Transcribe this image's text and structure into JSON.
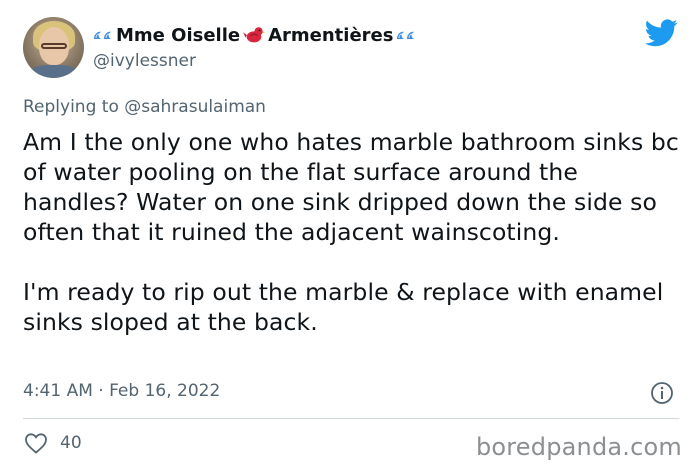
{
  "user": {
    "display_name_part1": "Mme Oiselle",
    "display_name_part2": "Armentières",
    "handle": "@ivylessner",
    "emoji_wave": "water-wave-icon",
    "emoji_bird": "red-bird-icon"
  },
  "reply": {
    "prefix": "Replying to",
    "to": "@sahrasulaiman"
  },
  "body": {
    "paragraph1": "Am I the only one who hates marble bathroom sinks bc of water pooling on the flat surface around the handles? Water on one sink dripped down the side so often that it ruined the adjacent wainscoting.",
    "paragraph2": "I'm ready to rip out the marble & replace with enamel sinks sloped at the back."
  },
  "meta": {
    "timestamp": "4:41 AM · Feb 16, 2022"
  },
  "actions": {
    "like_count": "40"
  },
  "watermark": "boredpanda.com",
  "colors": {
    "twitter_blue": "#1d9bf0",
    "text_primary": "#0f1419",
    "text_secondary": "#536471",
    "divider": "#cfd9de",
    "bird_red": "#d7263d"
  }
}
